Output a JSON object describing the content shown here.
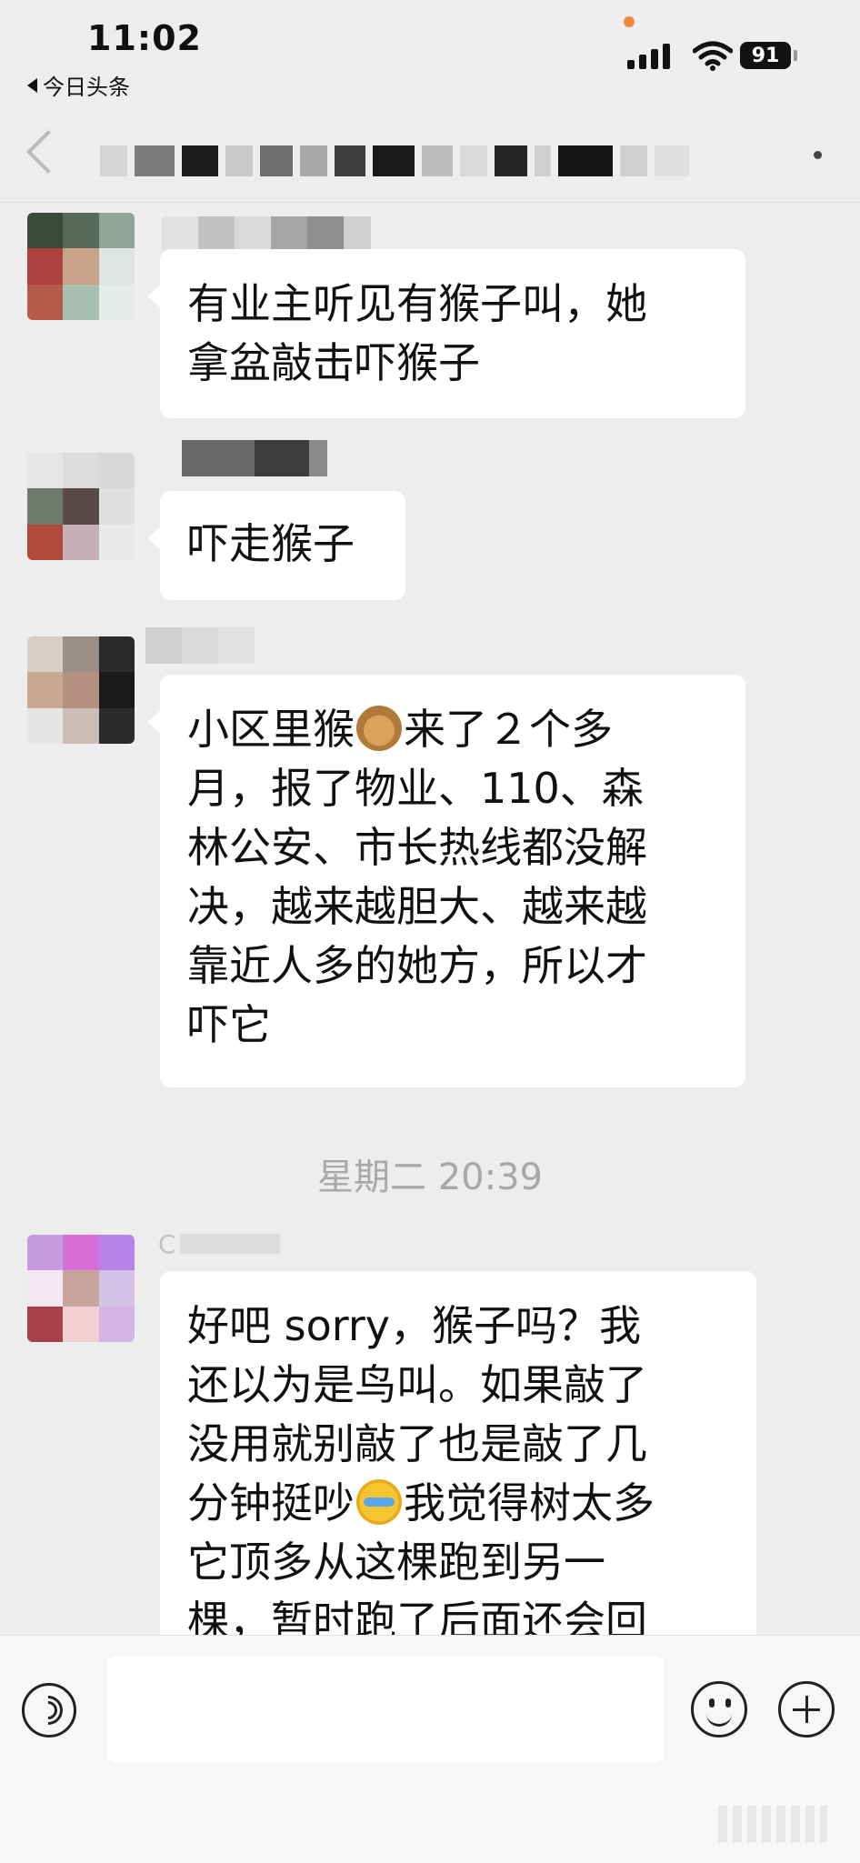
{
  "status_bar": {
    "time": "11:02",
    "back_app": "今日头条",
    "battery": "91"
  },
  "header": {
    "title_redacted": true
  },
  "messages": [
    {
      "lines": [
        "有业主听见有猴子叫，她",
        "拿盆敲击吓猴子"
      ]
    },
    {
      "lines": [
        "吓走猴子"
      ]
    },
    {
      "lines_before_emoji": "小区里猴",
      "emoji": "monkey-emoji",
      "line1_after_emoji": "来了２个多",
      "lines": [
        "月，报了物业、110、森",
        "林公安、市长热线都没解",
        "决，越来越胆大、越来越",
        "靠近人多的她方，所以才",
        "吓它"
      ]
    },
    {
      "sender_partial": "C",
      "lines": [
        "好吧 sorry，猴子吗？我",
        "还以为是鸟叫。如果敲了",
        "没用就别敲了也是敲了几"
      ],
      "line4_before_emoji": "分钟挺吵",
      "emoji": "crying-face-emoji",
      "line4_after_emoji": "我觉得树太多",
      "lines_after": [
        "它顶多从这棵跑到另一",
        "棵，暂时跑了后面还会回"
      ]
    }
  ],
  "timestamp": "星期二 20:39",
  "input_bar": {
    "placeholder": ""
  },
  "colors": {
    "background": "#ededed",
    "bubble": "#ffffff",
    "timestamp_text": "#a8a8a8"
  }
}
